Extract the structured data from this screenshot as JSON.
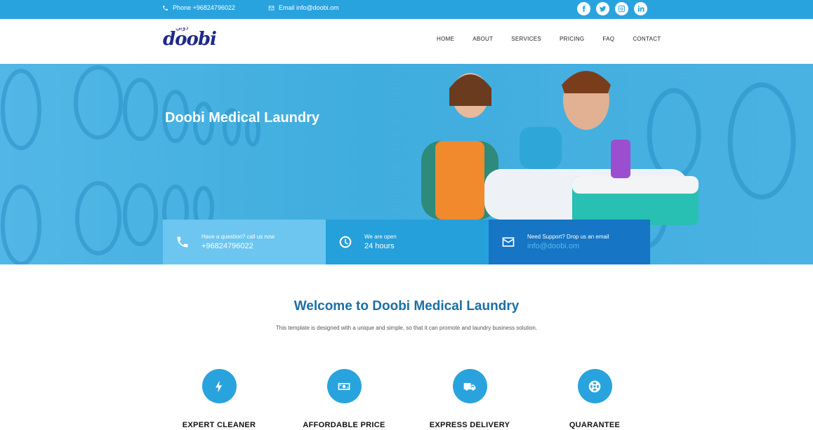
{
  "topbar": {
    "phone": "Phone +96824796022",
    "email": "Email info@doobi.om",
    "socials": [
      "facebook-icon",
      "twitter-icon",
      "instagram-icon",
      "linkedin-icon"
    ]
  },
  "logo": {
    "wordmark": "doobi",
    "arabic": "دوبي"
  },
  "nav": {
    "items": [
      "HOME",
      "ABOUT",
      "SERVICES",
      "PRICING",
      "FAQ",
      "CONTACT"
    ]
  },
  "hero": {
    "title": "Doobi Medical Laundry",
    "info": [
      {
        "small": "Have a question? call us now",
        "big": "+96824796022",
        "icon": "phone-icon"
      },
      {
        "small": "We are open",
        "big": "24 hours",
        "icon": "clock-icon"
      },
      {
        "small": "Need Support? Drop us an email",
        "big": "info@doobi.om",
        "icon": "envelope-icon"
      }
    ]
  },
  "welcome": {
    "title": "Welcome to Doobi Medical Laundry",
    "subtitle": "This template is designed with a unique and simple, so that it can promote and laundry business solution."
  },
  "features": [
    {
      "label": "EXPERT CLEANER",
      "icon": "bolt-icon"
    },
    {
      "label": "AFFORDABLE PRICE",
      "icon": "money-icon"
    },
    {
      "label": "EXPRESS DELIVERY",
      "icon": "truck-icon"
    },
    {
      "label": "QUARANTEE",
      "icon": "lifebuoy-icon"
    }
  ],
  "colors": {
    "primary": "#29a3de",
    "dark_blue": "#1675c4",
    "light_blue": "#6cc6f0",
    "title_blue": "#1b6fa6"
  }
}
